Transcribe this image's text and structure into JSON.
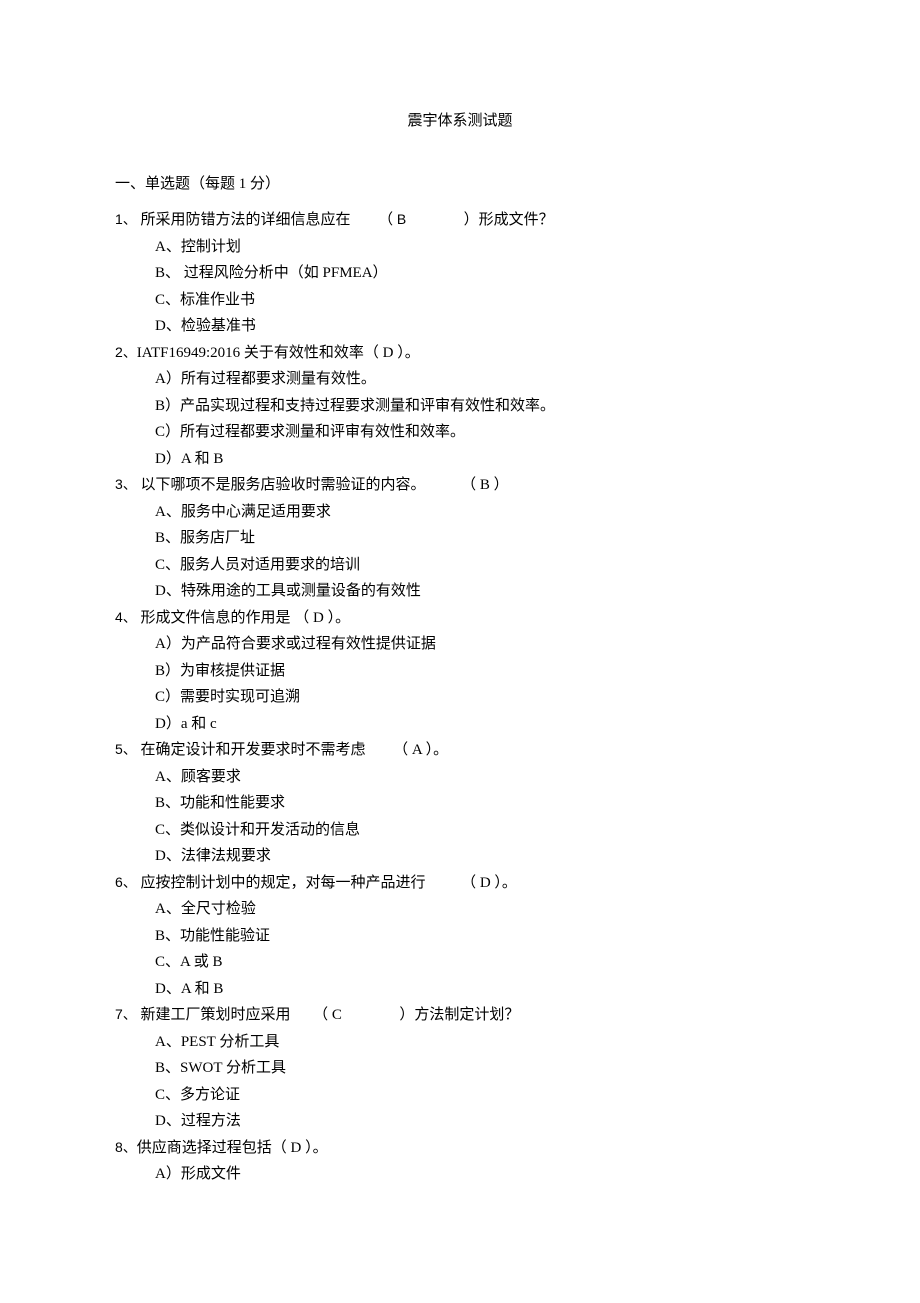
{
  "title": "震宇体系测试题",
  "section_header": "一、单选题（每题 1 分）",
  "questions": [
    {
      "num_prefix": "1、",
      "stem_parts": [
        "所采用防错方法的详细信息应在",
        "（",
        "B",
        "）形成文件？"
      ],
      "options": [
        "A、控制计划",
        "B、 过程风险分析中（如  PFMEA）",
        "C、标准作业书",
        "D、检验基准书"
      ]
    },
    {
      "num_prefix": "2、",
      "stem_parts": [
        "IATF16949:2016 关于有效性和效率（ D  ）。"
      ],
      "options": [
        "A）所有过程都要求测量有效性。",
        "B）产品实现过程和支持过程要求测量和评审有效性和效率。",
        "C）所有过程都要求测量和评审有效性和效率。",
        "D）A 和 B"
      ]
    },
    {
      "num_prefix": "3、",
      "stem_parts": [
        "以下哪项不是服务店验收时需验证的内容。",
        "（ B ）"
      ],
      "options": [
        "A、服务中心满足适用要求",
        "B、服务店厂址",
        "C、服务人员对适用要求的培训",
        "D、特殊用途的工具或测量设备的有效性"
      ]
    },
    {
      "num_prefix": "4、",
      "stem_parts": [
        "形成文件信息的作用是 （ D ）。"
      ],
      "options": [
        "A）为产品符合要求或过程有效性提供证据",
        "B）为审核提供证据",
        "C）需要时实现可追溯",
        "D）a 和 c"
      ]
    },
    {
      "num_prefix": "5、",
      "stem_parts": [
        "在确定设计和开发要求时不需考虑",
        "（ A ）。"
      ],
      "options": [
        "A、顾客要求",
        "B、功能和性能要求",
        "C、类似设计和开发活动的信息",
        "D、法律法规要求"
      ]
    },
    {
      "num_prefix": "6、",
      "stem_parts": [
        "应按控制计划中的规定，对每一种产品进行",
        "（ D ）。"
      ],
      "options": [
        "A、全尺寸检验",
        "B、功能性能验证",
        "C、A 或 B",
        "D、A 和 B"
      ]
    },
    {
      "num_prefix": "7、",
      "stem_parts": [
        "新建工厂策划时应采用",
        "（ C",
        "）方法制定计划？"
      ],
      "options": [
        "A、PEST 分析工具",
        "B、SWOT 分析工具",
        "C、多方论证",
        "D、过程方法"
      ]
    },
    {
      "num_prefix": "8、",
      "stem_parts": [
        "供应商选择过程包括（ D ）。"
      ],
      "options": [
        "A）形成文件"
      ]
    }
  ]
}
